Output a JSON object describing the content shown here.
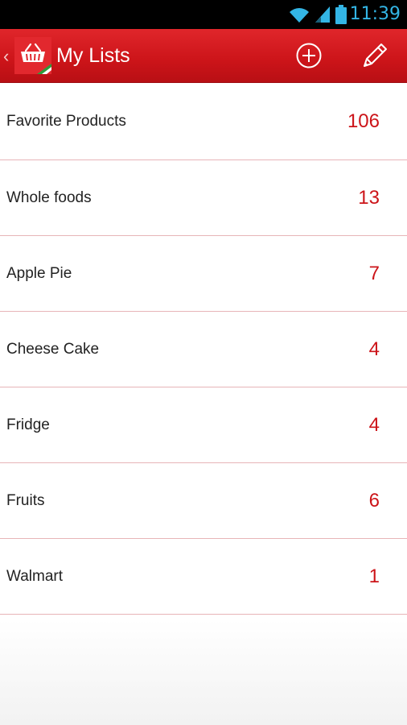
{
  "status_bar": {
    "time": "11:39",
    "icons": [
      "wifi-icon",
      "cell-signal-icon",
      "battery-icon"
    ]
  },
  "action_bar": {
    "title": "My Lists",
    "logo": "shopping-basket-icon",
    "actions": [
      {
        "name": "add-icon"
      },
      {
        "name": "pencil-icon"
      }
    ]
  },
  "lists": [
    {
      "name": "Favorite Products",
      "count": "106"
    },
    {
      "name": "Whole foods",
      "count": "13"
    },
    {
      "name": "Apple Pie",
      "count": "7"
    },
    {
      "name": "Cheese Cake",
      "count": "4"
    },
    {
      "name": "Fridge",
      "count": "4"
    },
    {
      "name": "Fruits",
      "count": "6"
    },
    {
      "name": "Walmart",
      "count": "1"
    }
  ],
  "colors": {
    "accent": "#cc1419",
    "status_time": "#33b5e5",
    "divider": "#e7b5b8"
  }
}
